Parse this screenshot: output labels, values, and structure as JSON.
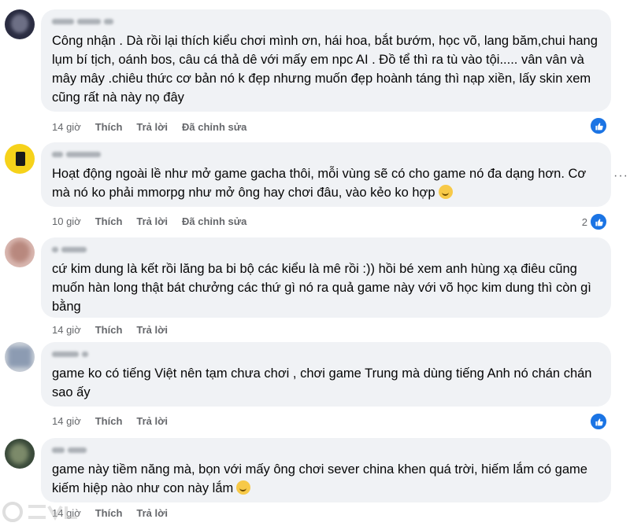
{
  "comments": [
    {
      "text": "Công nhận . Dà rồi lại thích kiểu chơi mình ơn, hái hoa, bắt bướm, học võ, lang băm,chui hang lụm bí tịch, oánh bos, câu cá thả dê với mấy em npc AI . Đồ tể thì ra tù vào tội..... vân vân và mây mây .chiêu thức cơ bản nó k đẹp nhưng muốn đẹp hoành táng thì nạp xiền, lấy skin xem cũng rất nà này nọ đây",
      "time": "14 giờ",
      "like": "Thích",
      "reply": "Trả lời",
      "edited": "Đã chỉnh sửa",
      "reaction_count": ""
    },
    {
      "text": "Hoạt động ngoài lề như mở game gacha thôi, mỗi vùng sẽ có cho game nó đa dạng hơn. Cơ mà nó ko phải mmorpg như mở ông hay chơi đâu, vào kẻo ko hợp",
      "time": "10 giờ",
      "like": "Thích",
      "reply": "Trả lời",
      "edited": "Đã chỉnh sửa",
      "reaction_count": "2"
    },
    {
      "text": "cứ kim dung là kết rồi lăng ba bi bộ các kiểu là mê rồi :)) hồi bé xem anh hùng xạ điêu cũng muốn hàn long thật bát chưởng các thứ gì nó ra quả game này với võ học kim dung thì còn gì bằng",
      "time": "14 giờ",
      "like": "Thích",
      "reply": "Trả lời",
      "edited": "",
      "reaction_count": ""
    },
    {
      "text": "game ko có tiếng Việt nên tạm chưa chơi , chơi game Trung mà dùng tiếng Anh nó chán chán sao ấy",
      "time": "14 giờ",
      "like": "Thích",
      "reply": "Trả lời",
      "edited": "",
      "reaction_count": ""
    },
    {
      "text": "game này tiềm năng mà, bọn với mấy ông chơi sever china khen quá trời, hiếm lắm có game kiếm hiệp nào như con này lắm",
      "time": "14 giờ",
      "like": "Thích",
      "reply": "Trả lời",
      "edited": "",
      "reaction_count": ""
    }
  ],
  "menu": {
    "more": "···"
  },
  "colors": {
    "like_blue": "#1b74e4",
    "bubble": "#f0f2f5",
    "meta": "#65676b"
  },
  "icons": [
    "like-icon",
    "smile-emoji-icon",
    "more-options-icon"
  ]
}
